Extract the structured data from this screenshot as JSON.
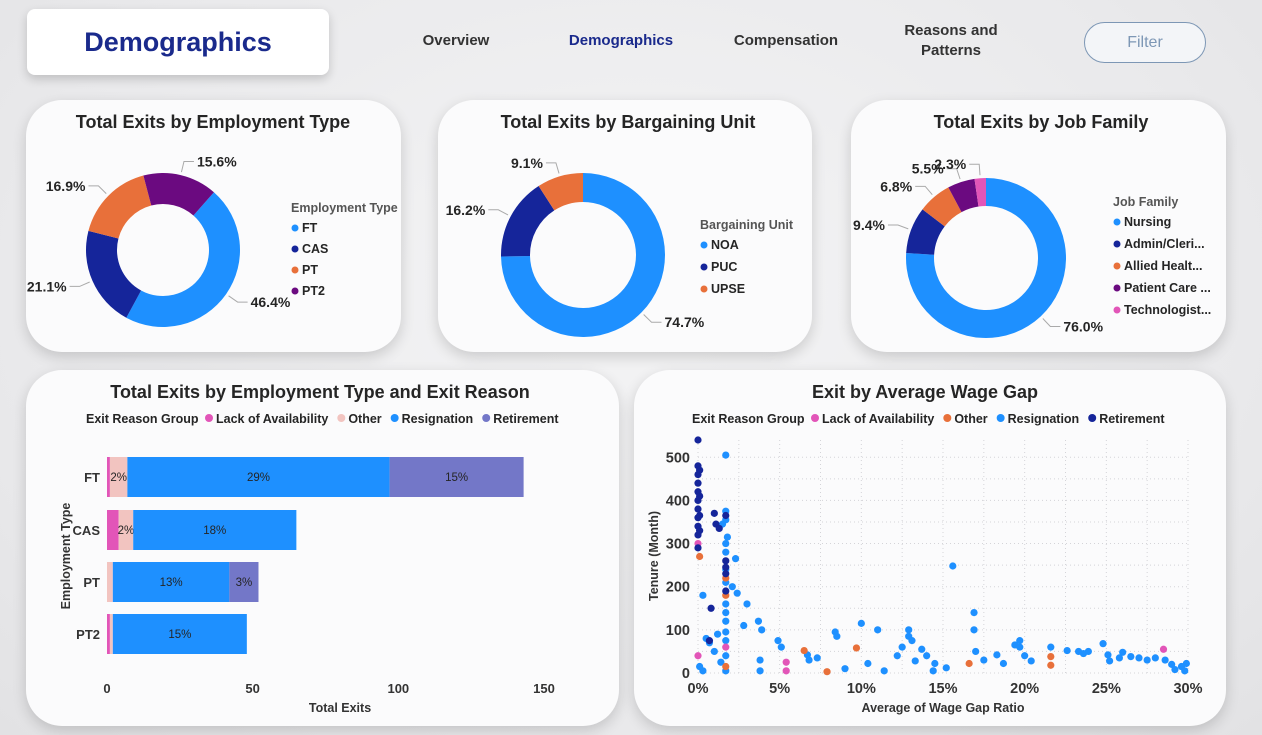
{
  "header": {
    "title": "Demographics",
    "nav": [
      {
        "label": "Overview"
      },
      {
        "label": "Demographics"
      },
      {
        "label": "Compensation"
      },
      {
        "label": "Reasons and Patterns"
      }
    ],
    "filter_label": "Filter"
  },
  "colors": {
    "light_blue": "#1e90ff",
    "navy": "#15259a",
    "orange": "#e8703a",
    "purple": "#6b0a80",
    "pink": "#e255b8",
    "light_pink": "#f2c4c0",
    "lavender": "#7377c8"
  },
  "chart_data": [
    {
      "id": "employment-type-donut",
      "type": "pie",
      "donut": true,
      "title": "Total Exits by Employment Type",
      "legend_title": "Employment Type",
      "legend_position": "right",
      "categories": [
        "FT",
        "CAS",
        "PT",
        "PT2"
      ],
      "values": [
        46.4,
        21.1,
        16.9,
        15.6
      ],
      "labels": [
        "46.4%",
        "21.1%",
        "16.9%",
        "15.6%"
      ],
      "colors": [
        "#1e90ff",
        "#15259a",
        "#e8703a",
        "#6b0a80"
      ]
    },
    {
      "id": "bargaining-unit-donut",
      "type": "pie",
      "donut": true,
      "title": "Total Exits by Bargaining Unit",
      "legend_title": "Bargaining Unit",
      "legend_position": "right",
      "categories": [
        "NOA",
        "PUC",
        "UPSE"
      ],
      "values": [
        74.7,
        16.2,
        9.1
      ],
      "labels": [
        "74.7%",
        "16.2%",
        "9.1%"
      ],
      "colors": [
        "#1e90ff",
        "#15259a",
        "#e8703a"
      ]
    },
    {
      "id": "job-family-donut",
      "type": "pie",
      "donut": true,
      "title": "Total Exits by Job Family",
      "legend_title": "Job Family",
      "legend_position": "right",
      "categories": [
        "Nursing",
        "Admin/Cleri...",
        "Allied Healt...",
        "Patient Care ...",
        "Technologist..."
      ],
      "values": [
        76.0,
        9.4,
        6.8,
        5.5,
        2.3
      ],
      "labels": [
        "76.0%",
        "9.4%",
        "6.8%",
        "5.5%",
        "2.3%"
      ],
      "colors": [
        "#1e90ff",
        "#15259a",
        "#e8703a",
        "#6b0a80",
        "#e255b8"
      ]
    },
    {
      "id": "stacked-bar",
      "type": "bar",
      "orientation": "horizontal",
      "stacked": true,
      "title": "Total Exits by Employment Type and Exit Reason",
      "legend_title": "Exit Reason Group",
      "legend_position": "top",
      "xlabel": "Total Exits",
      "ylabel": "Employment Type",
      "xlim": [
        0,
        150
      ],
      "xticks": [
        "0",
        "50",
        "100",
        "150"
      ],
      "categories": [
        "FT",
        "CAS",
        "PT",
        "PT2"
      ],
      "series": [
        {
          "name": "Lack of Availability",
          "color": "#e255b8",
          "values": [
            1,
            4,
            0,
            1
          ],
          "labels": [
            "",
            "",
            "",
            ""
          ]
        },
        {
          "name": "Other",
          "color": "#f2c4c0",
          "values": [
            6,
            5,
            2,
            1
          ],
          "labels": [
            "2%",
            "2%",
            "",
            ""
          ]
        },
        {
          "name": "Resignation",
          "color": "#1e90ff",
          "values": [
            90,
            56,
            40,
            46
          ],
          "labels": [
            "29%",
            "18%",
            "13%",
            "15%"
          ]
        },
        {
          "name": "Retirement",
          "color": "#7377c8",
          "values": [
            46,
            0,
            10,
            0
          ],
          "labels": [
            "15%",
            "",
            "3%",
            ""
          ]
        }
      ]
    },
    {
      "id": "wage-gap-scatter",
      "type": "scatter",
      "title": "Exit by Average Wage Gap",
      "legend_title": "Exit Reason Group",
      "legend_position": "top",
      "xlabel": "Average of Wage Gap Ratio",
      "ylabel": "Tenure (Month)",
      "xlim": [
        0,
        0.3
      ],
      "ylim": [
        0,
        540
      ],
      "xticks": [
        "0%",
        "5%",
        "10%",
        "15%",
        "20%",
        "25%",
        "30%"
      ],
      "yticks": [
        "0",
        "100",
        "200",
        "300",
        "400",
        "500"
      ],
      "grid": true,
      "series": [
        {
          "name": "Lack of Availability",
          "color": "#e255b8",
          "points": [
            [
              0.0,
              300
            ],
            [
              0.0,
              40
            ],
            [
              0.017,
              60
            ],
            [
              0.054,
              25
            ],
            [
              0.054,
              5
            ],
            [
              0.285,
              55
            ]
          ]
        },
        {
          "name": "Other",
          "color": "#e8703a",
          "points": [
            [
              0.001,
              270
            ],
            [
              0.017,
              220
            ],
            [
              0.017,
              180
            ],
            [
              0.017,
              15
            ],
            [
              0.065,
              52
            ],
            [
              0.079,
              3
            ],
            [
              0.097,
              58
            ],
            [
              0.166,
              22
            ],
            [
              0.216,
              38
            ],
            [
              0.216,
              18
            ]
          ]
        },
        {
          "name": "Resignation",
          "color": "#1e90ff",
          "points": [
            [
              0.017,
              505
            ],
            [
              0.015,
              345
            ],
            [
              0.017,
              375
            ],
            [
              0.017,
              355
            ],
            [
              0.017,
              300
            ],
            [
              0.017,
              280
            ],
            [
              0.017,
              240
            ],
            [
              0.017,
              210
            ],
            [
              0.017,
              160
            ],
            [
              0.017,
              140
            ],
            [
              0.017,
              120
            ],
            [
              0.017,
              95
            ],
            [
              0.017,
              75
            ],
            [
              0.017,
              40
            ],
            [
              0.017,
              5
            ],
            [
              0.014,
              25
            ],
            [
              0.01,
              50
            ],
            [
              0.005,
              80
            ],
            [
              0.003,
              180
            ],
            [
              0.023,
              265
            ],
            [
              0.018,
              315
            ],
            [
              0.021,
              200
            ],
            [
              0.024,
              185
            ],
            [
              0.03,
              160
            ],
            [
              0.037,
              120
            ],
            [
              0.039,
              100
            ],
            [
              0.028,
              110
            ],
            [
              0.001,
              15
            ],
            [
              0.003,
              5
            ],
            [
              0.007,
              70
            ],
            [
              0.012,
              90
            ],
            [
              0.038,
              30
            ],
            [
              0.038,
              5
            ],
            [
              0.049,
              75
            ],
            [
              0.051,
              60
            ],
            [
              0.067,
              42
            ],
            [
              0.068,
              30
            ],
            [
              0.073,
              35
            ],
            [
              0.084,
              95
            ],
            [
              0.085,
              85
            ],
            [
              0.09,
              10
            ],
            [
              0.1,
              115
            ],
            [
              0.104,
              22
            ],
            [
              0.11,
              100
            ],
            [
              0.114,
              5
            ],
            [
              0.122,
              40
            ],
            [
              0.125,
              60
            ],
            [
              0.129,
              100
            ],
            [
              0.129,
              85
            ],
            [
              0.131,
              75
            ],
            [
              0.133,
              28
            ],
            [
              0.137,
              55
            ],
            [
              0.14,
              40
            ],
            [
              0.144,
              5
            ],
            [
              0.145,
              22
            ],
            [
              0.152,
              12
            ],
            [
              0.156,
              248
            ],
            [
              0.169,
              140
            ],
            [
              0.169,
              100
            ],
            [
              0.17,
              50
            ],
            [
              0.175,
              30
            ],
            [
              0.183,
              42
            ],
            [
              0.187,
              22
            ],
            [
              0.194,
              65
            ],
            [
              0.197,
              60
            ],
            [
              0.197,
              75
            ],
            [
              0.2,
              40
            ],
            [
              0.204,
              28
            ],
            [
              0.216,
              60
            ],
            [
              0.226,
              52
            ],
            [
              0.233,
              50
            ],
            [
              0.236,
              45
            ],
            [
              0.239,
              50
            ],
            [
              0.248,
              68
            ],
            [
              0.251,
              42
            ],
            [
              0.252,
              28
            ],
            [
              0.258,
              35
            ],
            [
              0.26,
              48
            ],
            [
              0.265,
              38
            ],
            [
              0.27,
              35
            ],
            [
              0.275,
              30
            ],
            [
              0.28,
              35
            ],
            [
              0.286,
              30
            ],
            [
              0.29,
              20
            ],
            [
              0.292,
              8
            ],
            [
              0.296,
              15
            ],
            [
              0.298,
              5
            ],
            [
              0.299,
              22
            ]
          ]
        },
        {
          "name": "Retirement",
          "color": "#15259a",
          "points": [
            [
              0.0,
              540
            ],
            [
              0.0,
              480
            ],
            [
              0.0,
              460
            ],
            [
              0.0,
              440
            ],
            [
              0.0,
              420
            ],
            [
              0.0,
              400
            ],
            [
              0.0,
              380
            ],
            [
              0.0,
              360
            ],
            [
              0.0,
              340
            ],
            [
              0.0,
              320
            ],
            [
              0.0,
              290
            ],
            [
              0.001,
              470
            ],
            [
              0.001,
              410
            ],
            [
              0.001,
              365
            ],
            [
              0.001,
              330
            ],
            [
              0.01,
              370
            ],
            [
              0.011,
              345
            ],
            [
              0.013,
              335
            ],
            [
              0.017,
              365
            ],
            [
              0.017,
              260
            ],
            [
              0.017,
              245
            ],
            [
              0.017,
              230
            ],
            [
              0.017,
              190
            ],
            [
              0.008,
              150
            ],
            [
              0.007,
              75
            ]
          ]
        }
      ]
    }
  ]
}
